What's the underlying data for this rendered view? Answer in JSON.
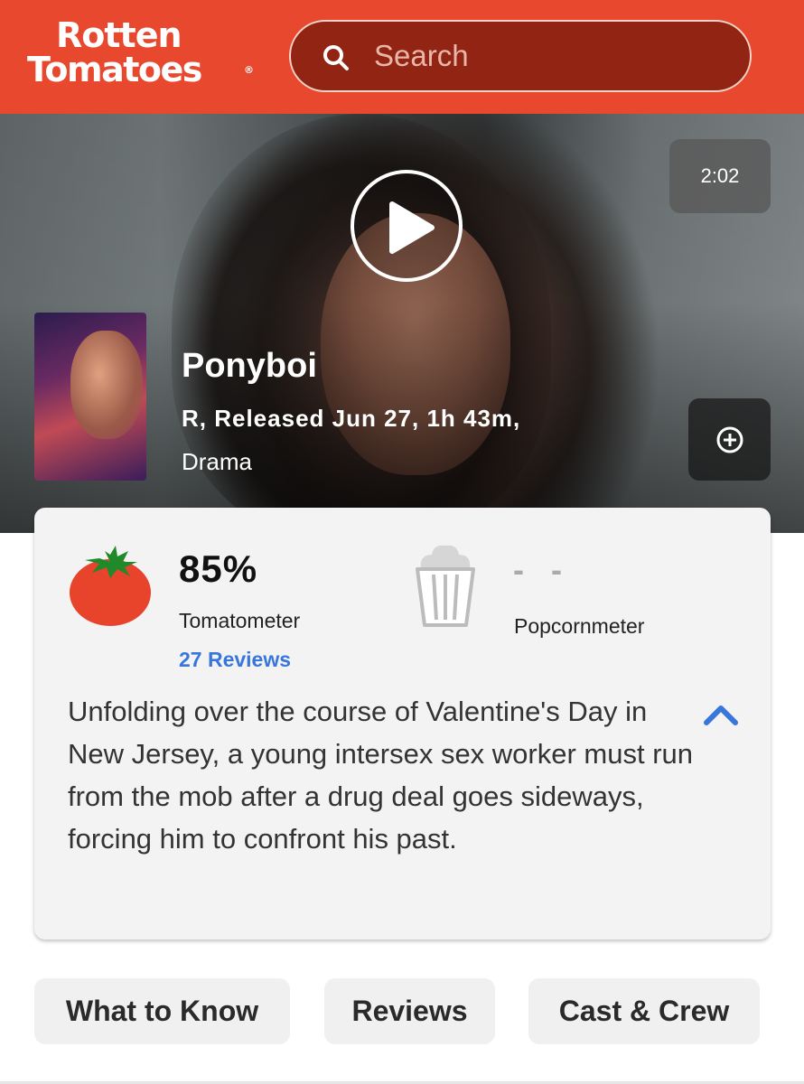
{
  "header": {
    "logo_line1": "Rotten",
    "logo_line2": "Tomatoes",
    "logo_mark": "®",
    "search_placeholder": "Search",
    "search_icon": "search-icon",
    "brand_color": "#E8482E"
  },
  "hero": {
    "duration": "2:02",
    "play_icon": "play-icon",
    "add_icon": "plus-circle-icon",
    "title": "Ponyboi",
    "meta": "R, Released Jun 27, 1h 43m,",
    "genre": "Drama"
  },
  "scores": {
    "tomatometer": {
      "value": "85%",
      "label": "Tomatometer",
      "reviews": "27 Reviews",
      "icon": "fresh-tomato-icon"
    },
    "popcornmeter": {
      "value": "- -",
      "label": "Popcornmeter",
      "icon": "empty-popcorn-icon"
    }
  },
  "synopsis": "Unfolding over the course of Valentine's Day in New Jersey, a young intersex sex worker must run from the mob after a drug deal goes sideways, forcing him to confront his past.",
  "tabs": [
    {
      "label": "What to Know"
    },
    {
      "label": "Reviews"
    },
    {
      "label": "Cast & Crew"
    }
  ],
  "colors": {
    "link": "#3976DC",
    "tomato": "#E8432B",
    "tomato_leaf": "#1E8A2A"
  }
}
